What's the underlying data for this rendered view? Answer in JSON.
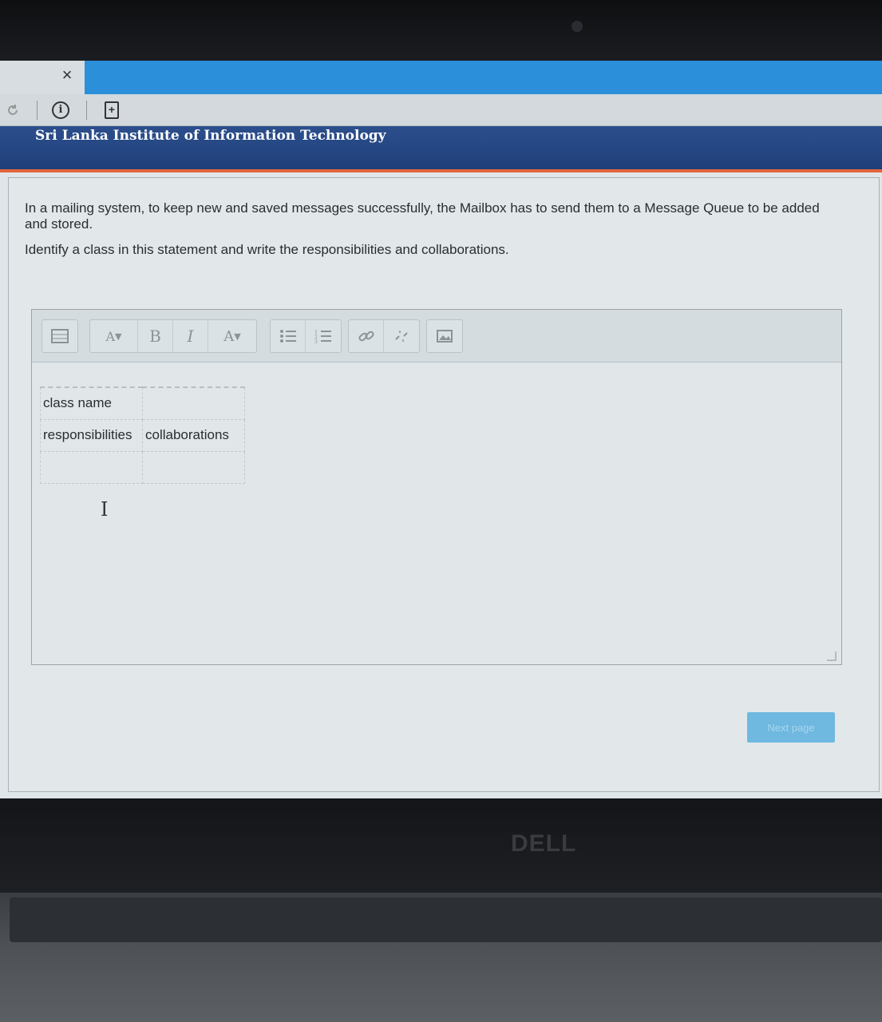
{
  "browser": {
    "tab_close": "×",
    "toolbar": {
      "reload_icon": "reload-icon",
      "info_icon": "info-icon",
      "page_icon": "page-add-icon"
    }
  },
  "site": {
    "title": "Sri Lanka Institute of Information Technology"
  },
  "question": {
    "statement": "In a mailing system, to keep new and saved messages successfully, the Mailbox has to send them to a Message Queue to be added and stored.",
    "instruction": "Identify a class in this statement and write the responsibilities and collaborations."
  },
  "editor": {
    "toolbar": {
      "font_size": "A",
      "bold": "B",
      "italic": "I",
      "color": "A"
    },
    "table": {
      "row1": [
        "class name",
        ""
      ],
      "row2": [
        "responsibilities",
        "collaborations"
      ],
      "row3": [
        "",
        ""
      ]
    }
  },
  "navigation": {
    "next_label": "Next page"
  },
  "device": {
    "brand": "DELL"
  }
}
